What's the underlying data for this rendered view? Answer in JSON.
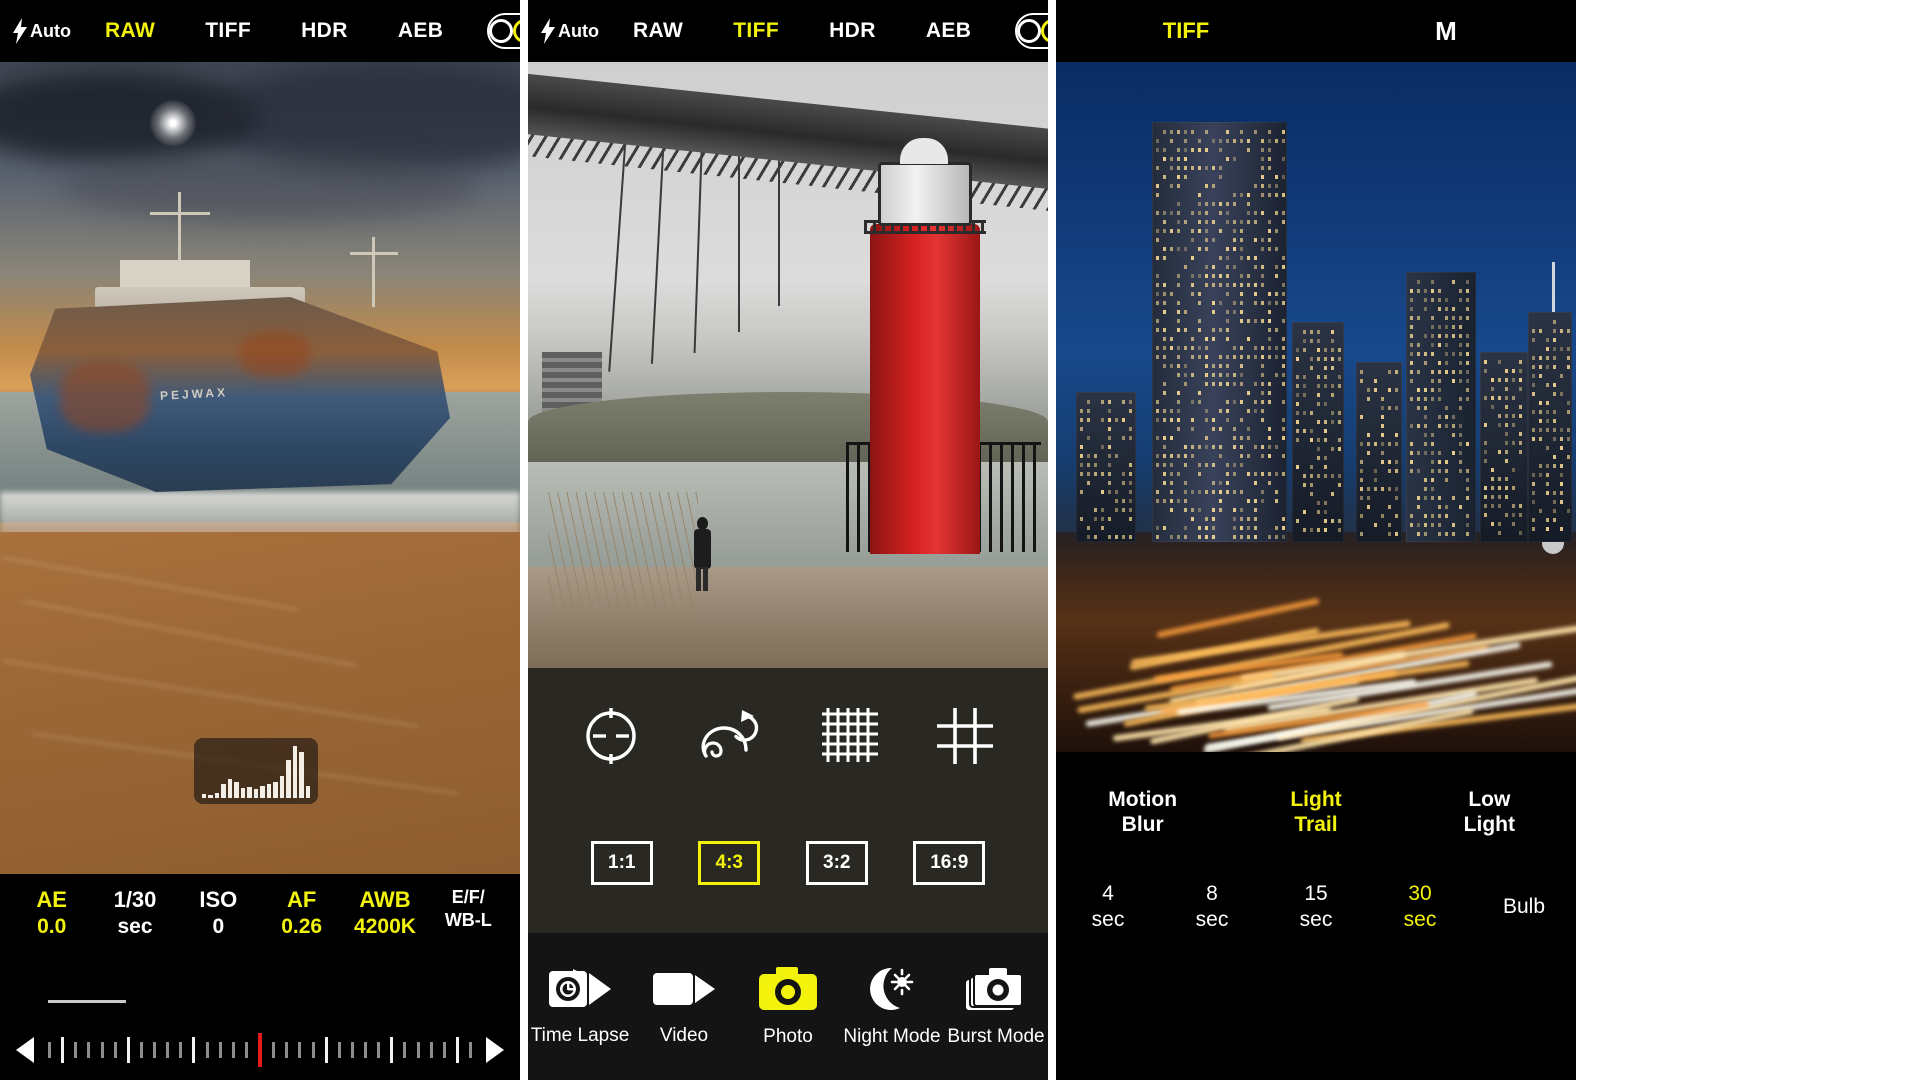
{
  "panel1": {
    "topbar": {
      "flash_icon": "flash-bolt-icon",
      "flash_label": "Auto",
      "items": [
        {
          "label": "RAW",
          "active": true
        },
        {
          "label": "TIFF",
          "active": false
        },
        {
          "label": "HDR",
          "active": false
        },
        {
          "label": "AEB",
          "active": false
        }
      ],
      "lens_toggle_icon": "dual-lens-toggle-icon",
      "flip_camera_icon": "camera-flip-icon"
    },
    "photo_alt": "shipwreck-on-beach-preview",
    "ship_name": "PEJWAX",
    "histogram_icon": "histogram-overlay",
    "histogram_bars": [
      4,
      3,
      5,
      14,
      19,
      16,
      10,
      11,
      9,
      12,
      14,
      16,
      22,
      38,
      52,
      46,
      12
    ],
    "settings": [
      {
        "line1": "AE",
        "line2": "0.0",
        "highlight": true
      },
      {
        "line1": "1/30",
        "line2": "sec",
        "highlight": false
      },
      {
        "line1": "ISO",
        "line2": "0",
        "highlight": false
      },
      {
        "line1": "AF",
        "line2": "0.26",
        "highlight": true
      },
      {
        "line1": "AWB",
        "line2": "4200K",
        "highlight": true
      },
      {
        "line1": "E/F/",
        "line2": "WB-L",
        "highlight": false
      }
    ],
    "dial": {
      "left_arrow_icon": "arrow-left-icon",
      "right_arrow_icon": "arrow-right-icon",
      "marker_color": "#e21b1b"
    }
  },
  "panel2": {
    "topbar": {
      "flash_icon": "flash-bolt-icon",
      "flash_label": "Auto",
      "items": [
        {
          "label": "RAW",
          "active": false
        },
        {
          "label": "TIFF",
          "active": true
        },
        {
          "label": "HDR",
          "active": false
        },
        {
          "label": "AEB",
          "active": false
        }
      ],
      "lens_toggle_icon": "dual-lens-toggle-icon",
      "flip_camera_icon": "camera-flip-icon"
    },
    "photo_alt": "bridge-and-red-lighthouse-preview",
    "tools": [
      {
        "icon": "focus-reticle-icon",
        "name": "focus-tool"
      },
      {
        "icon": "spiral-rotate-icon",
        "name": "rotate-tool"
      },
      {
        "icon": "fine-grid-icon",
        "name": "fine-grid-tool"
      },
      {
        "icon": "rule-of-thirds-grid-icon",
        "name": "thirds-grid-tool"
      }
    ],
    "aspect_ratios": [
      {
        "label": "1:1",
        "active": false
      },
      {
        "label": "4:3",
        "active": true
      },
      {
        "label": "3:2",
        "active": false
      },
      {
        "label": "16:9",
        "active": false
      }
    ],
    "modes": [
      {
        "label": "Time Lapse",
        "icon": "time-lapse-icon",
        "active": false
      },
      {
        "label": "Video",
        "icon": "video-camera-icon",
        "active": false
      },
      {
        "label": "Photo",
        "icon": "photo-camera-icon",
        "active": true
      },
      {
        "label": "Night Mode",
        "icon": "moon-star-icon",
        "active": false
      },
      {
        "label": "Burst Mode",
        "icon": "burst-camera-icon",
        "active": false
      }
    ]
  },
  "panel3": {
    "topbar": {
      "items": [
        {
          "label": "TIFF",
          "active": true
        },
        {
          "label": "M",
          "active": false
        }
      ]
    },
    "photo_alt": "city-skyline-night-light-trails-preview",
    "slider_icon": "vertical-slider-handle",
    "long_exposure_modes": [
      {
        "line1": "Motion",
        "line2": "Blur",
        "active": false
      },
      {
        "line1": "Light",
        "line2": "Trail",
        "active": true
      },
      {
        "line1": "Low",
        "line2": "Light",
        "active": false
      }
    ],
    "durations": [
      {
        "line1": "4",
        "line2": "sec",
        "active": false
      },
      {
        "line1": "8",
        "line2": "sec",
        "active": false
      },
      {
        "line1": "15",
        "line2": "sec",
        "active": false
      },
      {
        "line1": "30",
        "line2": "sec",
        "active": true
      },
      {
        "line1": "Bulb",
        "line2": "",
        "active": false
      }
    ]
  }
}
